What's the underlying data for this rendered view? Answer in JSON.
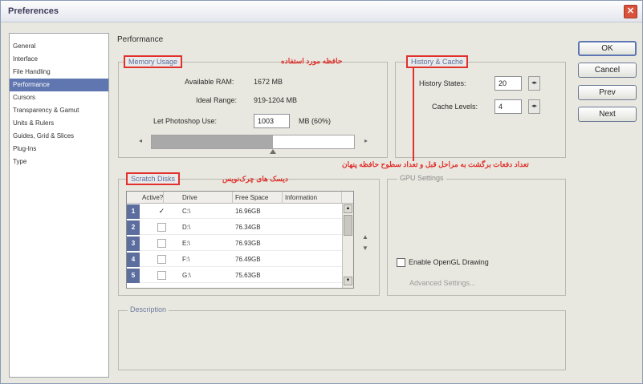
{
  "window": {
    "title": "Preferences",
    "close_glyph": "✕"
  },
  "sidebar": {
    "items": [
      {
        "label": "General",
        "selected": false
      },
      {
        "label": "Interface",
        "selected": false
      },
      {
        "label": "File Handling",
        "selected": false
      },
      {
        "label": "Performance",
        "selected": true
      },
      {
        "label": "Cursors",
        "selected": false
      },
      {
        "label": "Transparency & Gamut",
        "selected": false
      },
      {
        "label": "Units & Rulers",
        "selected": false
      },
      {
        "label": "Guides, Grid & Slices",
        "selected": false
      },
      {
        "label": "Plug-Ins",
        "selected": false
      },
      {
        "label": "Type",
        "selected": false
      }
    ]
  },
  "main": {
    "title": "Performance"
  },
  "memory": {
    "legend": "Memory Usage",
    "available_label": "Available RAM:",
    "available_value": "1672 MB",
    "ideal_label": "Ideal Range:",
    "ideal_value": "919-1204 MB",
    "let_use_label": "Let Photoshop Use:",
    "let_use_value": "1003",
    "let_use_unit": "MB (60%)",
    "slider_percent": 60,
    "slider_left": "◂",
    "slider_right": "▸"
  },
  "history": {
    "legend": "History & Cache",
    "states_label": "History States:",
    "states_value": "20",
    "levels_label": "Cache Levels:",
    "levels_value": "4",
    "spin_glyph": "◂▸"
  },
  "scratch": {
    "legend": "Scratch Disks",
    "columns": [
      "Active?",
      "Drive",
      "Free Space",
      "Information"
    ],
    "rows": [
      {
        "num": "1",
        "active": true,
        "drive": "C:\\",
        "free": "16.96GB",
        "info": ""
      },
      {
        "num": "2",
        "active": false,
        "drive": "D:\\",
        "free": "76.34GB",
        "info": ""
      },
      {
        "num": "3",
        "active": false,
        "drive": "E:\\",
        "free": "76.93GB",
        "info": ""
      },
      {
        "num": "4",
        "active": false,
        "drive": "F:\\",
        "free": "76.49GB",
        "info": ""
      },
      {
        "num": "5",
        "active": false,
        "drive": "G:\\",
        "free": "75.63GB",
        "info": ""
      }
    ],
    "check_glyph": "✓",
    "move_up": "▲",
    "move_down": "▼"
  },
  "gpu": {
    "legend": "GPU Settings",
    "enable_label": "Enable OpenGL Drawing",
    "advanced_label": "Advanced Settings..."
  },
  "description": {
    "legend": "Description"
  },
  "buttons": {
    "ok": "OK",
    "cancel": "Cancel",
    "prev": "Prev",
    "next": "Next"
  },
  "annotations": {
    "memory": "حافظه مورد استفاده",
    "history": "تعداد دفعات برگشت به مراحل قبل و تعداد سطوح حافظه پنهان",
    "scratch": "دیسک های چرک‌نویس"
  },
  "colors": {
    "annotation_red": "#e0312c",
    "selection_blue": "#5f76b0"
  }
}
